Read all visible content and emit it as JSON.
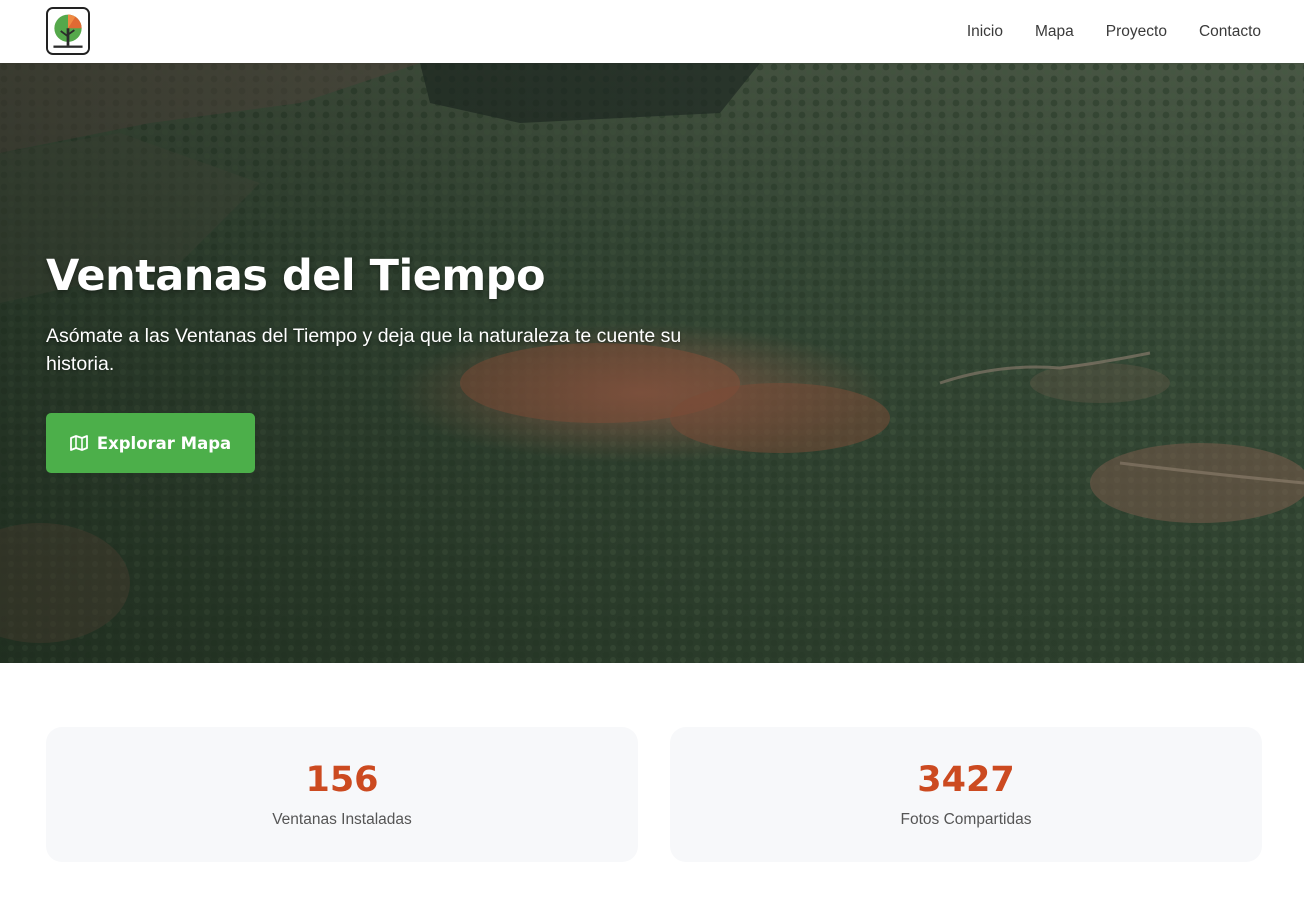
{
  "header": {
    "logo_icon": "tree-logo-icon",
    "nav": [
      {
        "label": "Inicio"
      },
      {
        "label": "Mapa"
      },
      {
        "label": "Proyecto"
      },
      {
        "label": "Contacto"
      }
    ]
  },
  "hero": {
    "title": "Ventanas del Tiempo",
    "subtitle": "Asómate a las Ventanas del Tiempo y deja que la naturaleza te cuente su historia.",
    "button": {
      "label": "Explorar Mapa",
      "icon": "map-icon"
    },
    "background": "aerial-forest-village-photo"
  },
  "stats": [
    {
      "value": "156",
      "label": "Ventanas Instaladas"
    },
    {
      "value": "3427",
      "label": "Fotos Compartidas"
    }
  ],
  "colors": {
    "accent_green": "#4caf4a",
    "stat_orange": "#cc4a20",
    "card_bg": "#f7f8fa"
  }
}
